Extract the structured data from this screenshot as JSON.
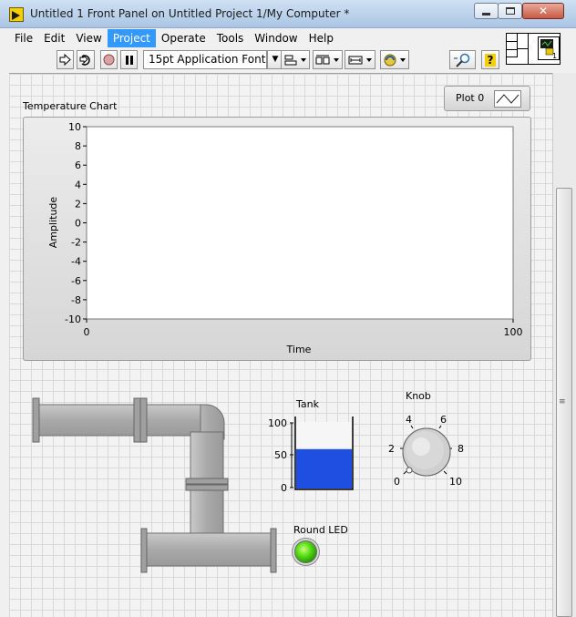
{
  "window": {
    "title": "Untitled 1 Front Panel on Untitled Project 1/My Computer *",
    "close_glyph": "✕"
  },
  "menu": {
    "items": [
      {
        "label": "File"
      },
      {
        "label": "Edit"
      },
      {
        "label": "View"
      },
      {
        "label": "Project",
        "active": true
      },
      {
        "label": "Operate"
      },
      {
        "label": "Tools"
      },
      {
        "label": "Window"
      },
      {
        "label": "Help"
      }
    ]
  },
  "toolbar": {
    "run_icon": "run-arrow-icon",
    "run_continuously_icon": "run-continuously-icon",
    "abort_icon": "abort-icon",
    "pause_icon": "pause-icon",
    "font": "15pt Application Font",
    "align_icon": "align-objects-icon",
    "distribute_icon": "distribute-objects-icon",
    "resize_icon": "resize-objects-icon",
    "reorder_icon": "reorder-icon",
    "search_icon": "search-icon",
    "help_icon": "context-help-icon",
    "help_glyph": "?",
    "dropdown_glyph": "▼"
  },
  "connector": {
    "number": "1"
  },
  "chart": {
    "label": "Temperature Chart",
    "legend_name": "Plot 0",
    "frame_color": "#d6d6d6",
    "plot_bg": "#ffffff"
  },
  "chart_data": {
    "type": "line",
    "title": "Temperature Chart",
    "xlabel": "Time",
    "ylabel": "Amplitude",
    "xlim": [
      0,
      100
    ],
    "ylim": [
      -10,
      10
    ],
    "x_ticks": [
      0,
      100
    ],
    "y_ticks": [
      10,
      8,
      6,
      4,
      2,
      0,
      -2,
      -4,
      -6,
      -8,
      -10
    ],
    "series": [
      {
        "name": "Plot 0",
        "values": []
      }
    ],
    "legend": "top-right",
    "grid": false
  },
  "tank": {
    "label": "Tank",
    "value_percent": 60,
    "scale": [
      "100",
      "50",
      "0"
    ],
    "fill_color": "#1f4fe0"
  },
  "knob": {
    "label": "Knob",
    "scale": [
      "0",
      "2",
      "4",
      "6",
      "8",
      "10"
    ],
    "value": 0
  },
  "led": {
    "label": "Round LED",
    "state": "on",
    "color": "#44d40c"
  }
}
